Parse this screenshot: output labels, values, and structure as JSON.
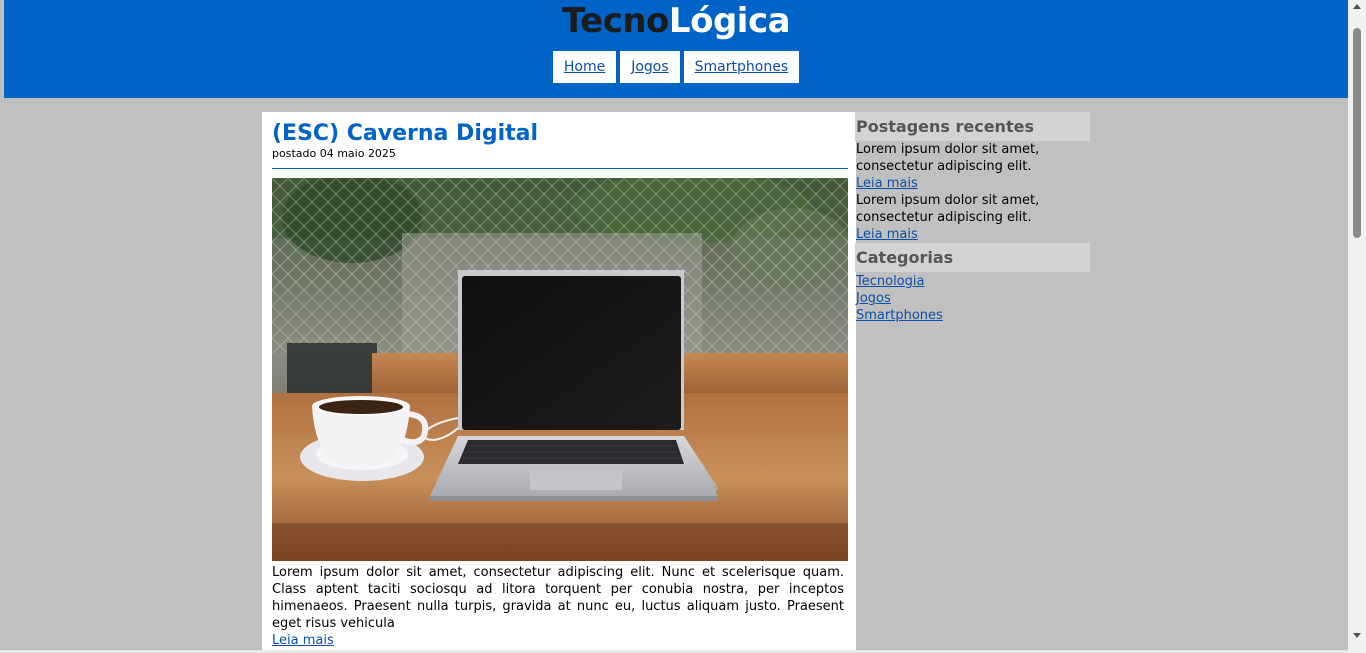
{
  "site": {
    "title_part1": "Tecno",
    "title_part2": "Lógica",
    "brand_color": "#0063c8"
  },
  "nav": {
    "items": [
      {
        "label": "Home"
      },
      {
        "label": "Jogos"
      },
      {
        "label": "Smartphones"
      }
    ]
  },
  "post": {
    "title": "(ESC) Caverna Digital",
    "date": "postado 04 maio 2025",
    "image": "laptop-and-coffee-photo",
    "excerpt": "Lorem ipsum dolor sit amet, consectetur adipiscing elit. Nunc et scelerisque quam. Class aptent taciti sociosqu ad litora torquent per conubia nostra, per inceptos himenaeos. Praesent nulla turpis, gravida at nunc eu, luctus aliquam justo. Praesent eget risus vehicula",
    "read_more": "Leia mais"
  },
  "sidebar": {
    "recent_title": "Postagens recentes",
    "recent": [
      {
        "text": "Lorem ipsum dolor sit amet, consectetur adipiscing elit.",
        "link": "Leia mais"
      },
      {
        "text": "Lorem ipsum dolor sit amet, consectetur adipiscing elit.",
        "link": "Leia mais"
      }
    ],
    "categories_title": "Categorias",
    "categories": [
      "Tecnologia",
      "Jogos",
      "Smartphones"
    ]
  }
}
